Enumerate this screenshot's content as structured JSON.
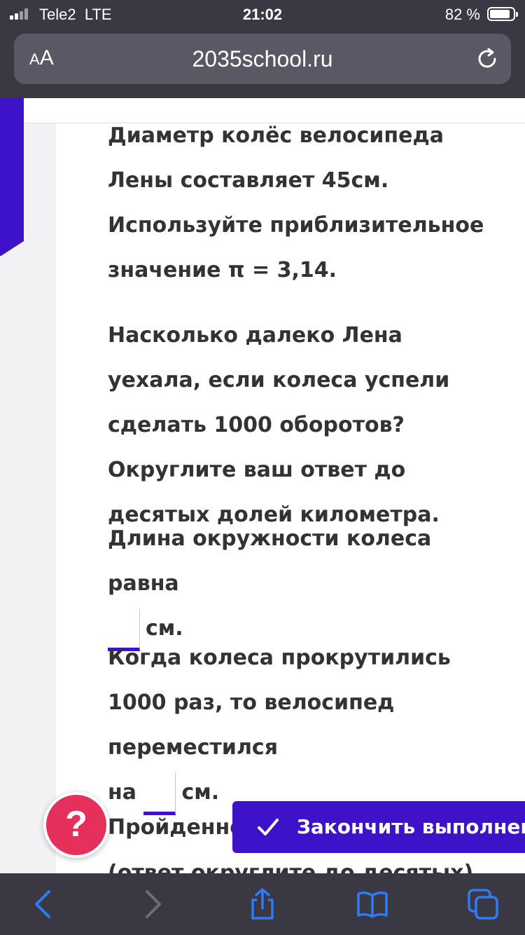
{
  "status": {
    "carrier": "Tele2",
    "network": "LTE",
    "time": "21:02",
    "battery": "82 %"
  },
  "urlbar": {
    "aa_small": "A",
    "aa_big": "A",
    "url": "2035school.ru"
  },
  "content": {
    "p1": "Диаметр колёс велосипеда Лены составляет 45см. Используйте приблизительное значение π = 3,14.",
    "p2": "Насколько далеко Лена уехала, если колеса успели сделать 1000 оборотов? Округлите ваш ответ до десятых долей километра.",
    "p3_text": "Длина окружности колеса равна",
    "p3_unit": "см.",
    "p4_text": "Когда колеса прокрутились 1000 раз, то велосипед переместился",
    "p4_prefix": "на",
    "p4_unit": "см.",
    "p5_visible": "Пройденно",
    "p6_partial": "(ответ округлите до десятых)"
  },
  "help_button": "?",
  "finish_button": "Закончить выполнен",
  "icons": {
    "reload": "reload-icon",
    "check": "check-icon",
    "back": "chevron-left-icon",
    "forward": "chevron-right-icon",
    "share": "share-icon",
    "bookmarks": "book-icon",
    "tabs": "tabs-icon"
  },
  "colors": {
    "accent": "#3d12c8",
    "help": "#e6305c",
    "chrome": "#3a3843",
    "ios_blue": "#2f7bf6"
  }
}
